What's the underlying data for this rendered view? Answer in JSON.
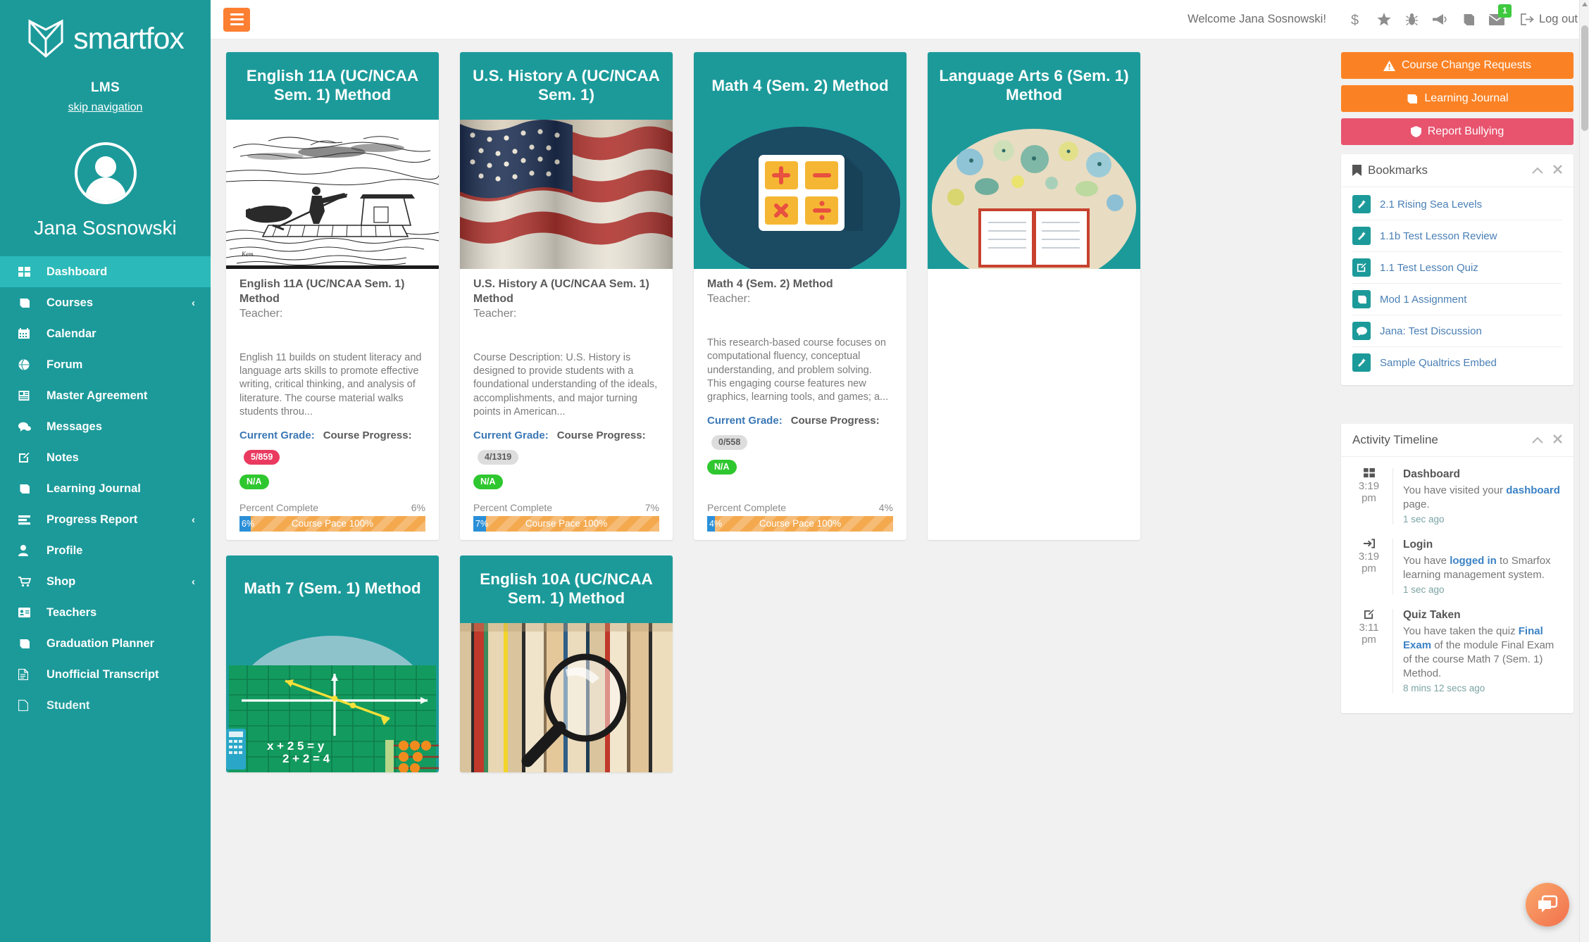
{
  "sidebar": {
    "brand": "smartfox",
    "subtitle": "LMS",
    "skip_nav": "skip navigation",
    "user_name": "Jana Sosnowski",
    "items": [
      {
        "label": "Dashboard",
        "icon": "grid-icon",
        "active": true,
        "caret": false
      },
      {
        "label": "Courses",
        "icon": "book-icon",
        "active": false,
        "caret": true
      },
      {
        "label": "Calendar",
        "icon": "calendar-icon",
        "active": false,
        "caret": false
      },
      {
        "label": "Forum",
        "icon": "globe-icon",
        "active": false,
        "caret": false
      },
      {
        "label": "Master Agreement",
        "icon": "document-icon",
        "active": false,
        "caret": false
      },
      {
        "label": "Messages",
        "icon": "comments-icon",
        "active": false,
        "caret": false
      },
      {
        "label": "Notes",
        "icon": "edit-icon",
        "active": false,
        "caret": false
      },
      {
        "label": "Learning Journal",
        "icon": "book-icon",
        "active": false,
        "caret": false
      },
      {
        "label": "Progress Report",
        "icon": "report-icon",
        "active": false,
        "caret": true
      },
      {
        "label": "Profile",
        "icon": "user-icon",
        "active": false,
        "caret": false
      },
      {
        "label": "Shop",
        "icon": "cart-icon",
        "active": false,
        "caret": true
      },
      {
        "label": "Teachers",
        "icon": "id-card-icon",
        "active": false,
        "caret": false
      },
      {
        "label": "Graduation Planner",
        "icon": "book-icon",
        "active": false,
        "caret": false
      },
      {
        "label": "Unofficial Transcript",
        "icon": "file-icon",
        "active": false,
        "caret": false
      },
      {
        "label": "Student",
        "icon": "file-icon",
        "active": false,
        "caret": false
      }
    ]
  },
  "topbar": {
    "menu_toggle": "menu-icon",
    "welcome": "Welcome Jana Sosnowski!",
    "icons": [
      {
        "name": "dollar-icon",
        "glyph": "$"
      },
      {
        "name": "star-icon",
        "glyph": "star"
      },
      {
        "name": "bug-icon",
        "glyph": "bug"
      },
      {
        "name": "bullhorn-icon",
        "glyph": "bullhorn"
      },
      {
        "name": "book-icon",
        "glyph": "book"
      },
      {
        "name": "envelope-icon",
        "glyph": "envelope",
        "badge": "1"
      }
    ],
    "logout": "Log out"
  },
  "courses": [
    {
      "header": "English 11A (UC/NCAA Sem. 1) Method",
      "title": "English 11A (UC/NCAA Sem. 1) Method",
      "teacher_label": "Teacher:",
      "description": "English 11 builds on student literacy and language arts skills to promote effective writing, critical thinking, and analysis of literature. The course material walks students throu...",
      "grade_label": "Current Grade:",
      "grade_value": "N/A",
      "progress_label": "Course Progress:",
      "progress_value": "5/859",
      "progress_badge_color": "red",
      "percent_label": "Percent Complete",
      "percent_value": "6%",
      "bar_value": "6%",
      "pace_label": "Course Pace 100%",
      "art": "raft-illustration"
    },
    {
      "header": "U.S. History A (UC/NCAA Sem. 1)",
      "title": "U.S. History A (UC/NCAA Sem. 1) Method",
      "teacher_label": "Teacher:",
      "description": "Course Description:  U.S. History is designed to provide students with a foundational understanding of the ideals, accomplishments, and major turning points in American...",
      "grade_label": "Current Grade:",
      "grade_value": "N/A",
      "progress_label": "Course Progress:",
      "progress_value": "4/1319",
      "progress_badge_color": "gray",
      "percent_label": "Percent Complete",
      "percent_value": "7%",
      "bar_value": "7%",
      "pace_label": "Course Pace 100%",
      "art": "american-flag"
    },
    {
      "header": "Math 4 (Sem. 2) Method",
      "title": "Math 4 (Sem. 2) Method",
      "teacher_label": "Teacher:",
      "description": "This research-based course focuses on computational fluency, conceptual understanding, and problem solving. This engaging course features new graphics, learning tools, and games; a...",
      "grade_label": "Current Grade:",
      "grade_value": "N/A",
      "progress_label": "Course Progress:",
      "progress_value": "0/558",
      "progress_badge_color": "gray",
      "percent_label": "Percent Complete",
      "percent_value": "4%",
      "bar_value": "4%",
      "pace_label": "Course Pace 100%",
      "art": "calculator-illustration"
    },
    {
      "header": "Language Arts 6 (Sem. 1) Method",
      "art": "book-illustration"
    },
    {
      "header": "Math 7 (Sem. 1) Method",
      "art": "graph-illustration"
    },
    {
      "header": "English 10A (UC/NCAA Sem. 1) Method",
      "art": "books-magnifier"
    }
  ],
  "right": {
    "buttons": [
      {
        "label": "Course Change Requests",
        "icon": "warning-icon",
        "style": "orange"
      },
      {
        "label": "Learning Journal",
        "icon": "book-icon",
        "style": "orange"
      },
      {
        "label": "Report Bullying",
        "icon": "shield-icon",
        "style": "pink"
      }
    ],
    "bookmarks": {
      "title": "Bookmarks",
      "icon": "bookmark-icon",
      "collapse": "collapse-icon",
      "close": "close-icon",
      "items": [
        {
          "label": "2.1 Rising Sea Levels",
          "icon": "magic-wand-icon"
        },
        {
          "label": "1.1b Test Lesson Review",
          "icon": "magic-wand-icon"
        },
        {
          "label": "1.1 Test Lesson Quiz",
          "icon": "edit-icon"
        },
        {
          "label": "Mod 1 Assignment",
          "icon": "book-icon"
        },
        {
          "label": "Jana: Test Discussion",
          "icon": "comment-icon"
        },
        {
          "label": "Sample Qualtrics Embed",
          "icon": "magic-wand-icon"
        }
      ]
    },
    "timeline": {
      "title": "Activity Timeline",
      "collapse": "collapse-icon",
      "close": "close-icon",
      "items": [
        {
          "icon": "grid-icon",
          "time": "3:19 pm",
          "title": "Dashboard",
          "text_before": "You have visited your ",
          "link": "dashboard",
          "text_after": " page.",
          "ago": "1 sec ago"
        },
        {
          "icon": "login-icon",
          "time": "3:19 pm",
          "title": "Login",
          "text_before": "You have ",
          "link": "logged in",
          "text_after": " to Smarfox learning management system.",
          "ago": "1 sec ago"
        },
        {
          "icon": "edit-icon",
          "time": "3:11 pm",
          "title": "Quiz Taken",
          "text_before": "You have taken the quiz ",
          "link": "Final Exam",
          "text_after": " of the module Final Exam of the course Math 7 (Sem. 1) Method.",
          "ago": "8 mins 12 secs ago"
        }
      ]
    }
  },
  "chat": {
    "icon": "chat-icon"
  },
  "colors": {
    "teal": "#1c9a9a",
    "teal_active": "#2bb9b9",
    "orange": "#fb8224",
    "pink": "#e8536e",
    "blue": "#2b8fd8",
    "green": "#2fc72f",
    "red": "#ea3a60",
    "pace_orange": "#f4a94f"
  }
}
